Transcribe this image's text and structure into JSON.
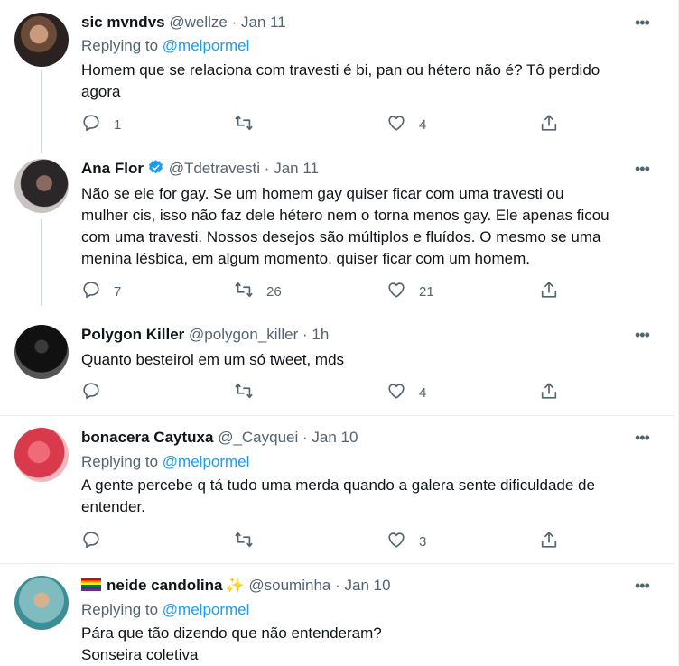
{
  "tweets": [
    {
      "name": "sic mvndvs",
      "handle": "@wellze",
      "sep": "·",
      "time": "Jan 11",
      "replying_prefix": "Replying to",
      "replying_handle": "@melpormel",
      "text_lines": [
        "Homem que se relaciona com travesti é bi, pan ou hétero não é? Tô perdido",
        "agora"
      ],
      "replies": "1",
      "retweets": "",
      "likes": "4"
    },
    {
      "name": "Ana Flor",
      "verified": true,
      "handle": "@Tdetravesti",
      "sep": "·",
      "time": "Jan 11",
      "text_lines": [
        "Não se ele for gay. Se um homem gay quiser ficar com uma travesti ou",
        "mulher cis, isso não faz dele hétero nem o torna menos gay. Ele apenas ficou",
        "com uma travesti. Nossos desejos são múltiplos e fluídos. O mesmo se uma",
        "menina lésbica, em algum momento, quiser ficar com um homem."
      ],
      "replies": "7",
      "retweets": "26",
      "likes": "21"
    },
    {
      "name": "Polygon Killer",
      "handle": "@polygon_killer",
      "sep": "·",
      "time": "1h",
      "text_lines": [
        "Quanto besteirol em um só tweet, mds"
      ],
      "replies": "",
      "retweets": "",
      "likes": "4"
    },
    {
      "name": "bonacera Caytuxa",
      "handle": "@_Cayquei",
      "sep": "·",
      "time": "Jan 10",
      "replying_prefix": "Replying to",
      "replying_handle": "@melpormel",
      "text_lines": [
        "A gente percebe q tá tudo uma merda quando a galera sente dificuldade de",
        "entender."
      ],
      "replies": "",
      "retweets": "",
      "likes": "3"
    },
    {
      "name": "neide candolina",
      "name_sparkle": "✨",
      "handle": "@souminha",
      "sep": "·",
      "time": "Jan 10",
      "replying_prefix": "Replying to",
      "replying_handle": "@melpormel",
      "text_lines": [
        "Pára que tão dizendo que não entenderam?",
        "Sonseira coletiva"
      ]
    }
  ],
  "icons": {
    "reply": "reply-icon",
    "retweet": "retweet-icon",
    "like": "like-icon",
    "share": "share-icon",
    "more": "more-icon",
    "verified": "verified-badge-icon",
    "flag": "rainbow-flag-icon"
  },
  "colors": {
    "link": "#1d9bf0",
    "muted": "#536471",
    "text": "#0f1419",
    "thread": "#cfd9de"
  }
}
